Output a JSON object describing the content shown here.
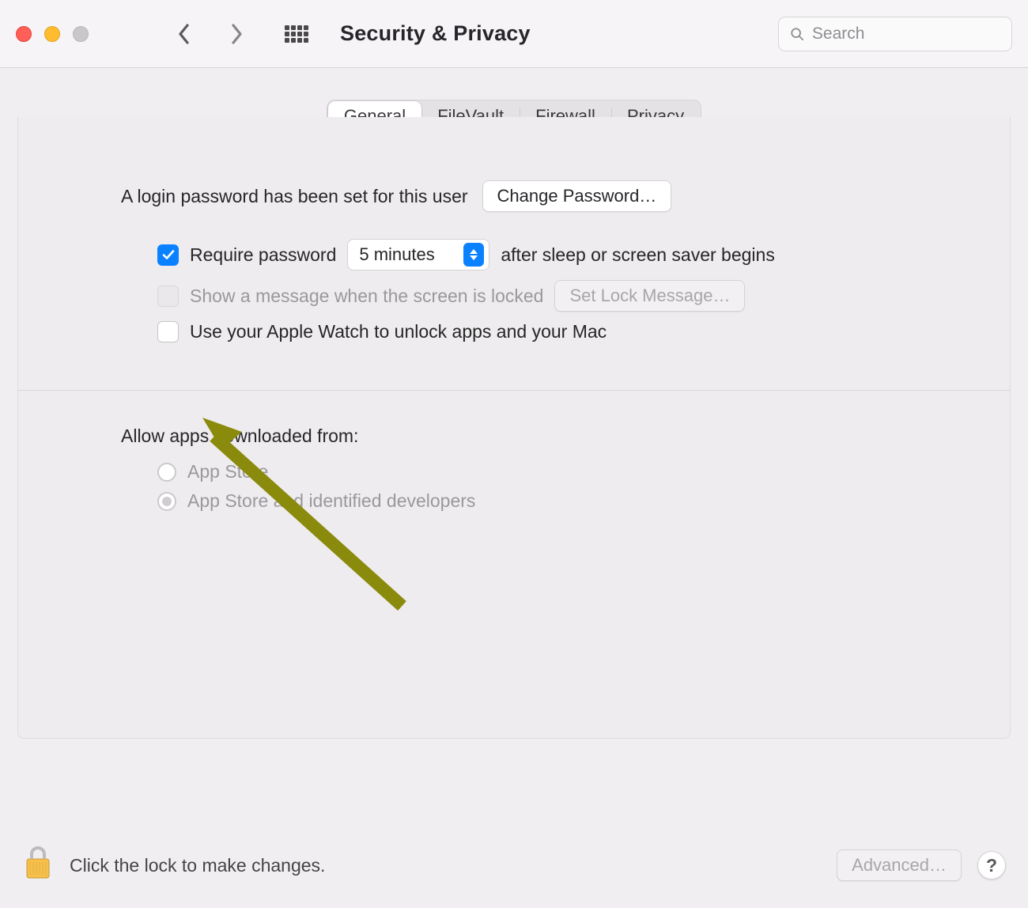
{
  "header": {
    "title": "Security & Privacy",
    "search_placeholder": "Search"
  },
  "tabs": [
    {
      "label": "General",
      "selected": true
    },
    {
      "label": "FileVault",
      "selected": false
    },
    {
      "label": "Firewall",
      "selected": false
    },
    {
      "label": "Privacy",
      "selected": false
    }
  ],
  "general": {
    "login_set_text": "A login password has been set for this user",
    "change_password_btn": "Change Password…",
    "require_password_checked": true,
    "require_password_label": "Require password",
    "require_password_delay_value": "5 minutes",
    "require_password_after": "after sleep or screen saver begins",
    "show_message_checked": false,
    "show_message_enabled": false,
    "show_message_label": "Show a message when the screen is locked",
    "set_lock_message_btn": "Set Lock Message…",
    "apple_watch_checked": false,
    "apple_watch_label": "Use your Apple Watch to unlock apps and your Mac",
    "allow_apps_heading": "Allow apps downloaded from:",
    "allow_apps_options": [
      {
        "label": "App Store",
        "selected": false
      },
      {
        "label": "App Store and identified developers",
        "selected": true
      }
    ]
  },
  "footer": {
    "lock_text": "Click the lock to make changes.",
    "advanced_btn": "Advanced…",
    "help_label": "?"
  },
  "annotation": {
    "arrow_color": "#8a8a0d"
  }
}
